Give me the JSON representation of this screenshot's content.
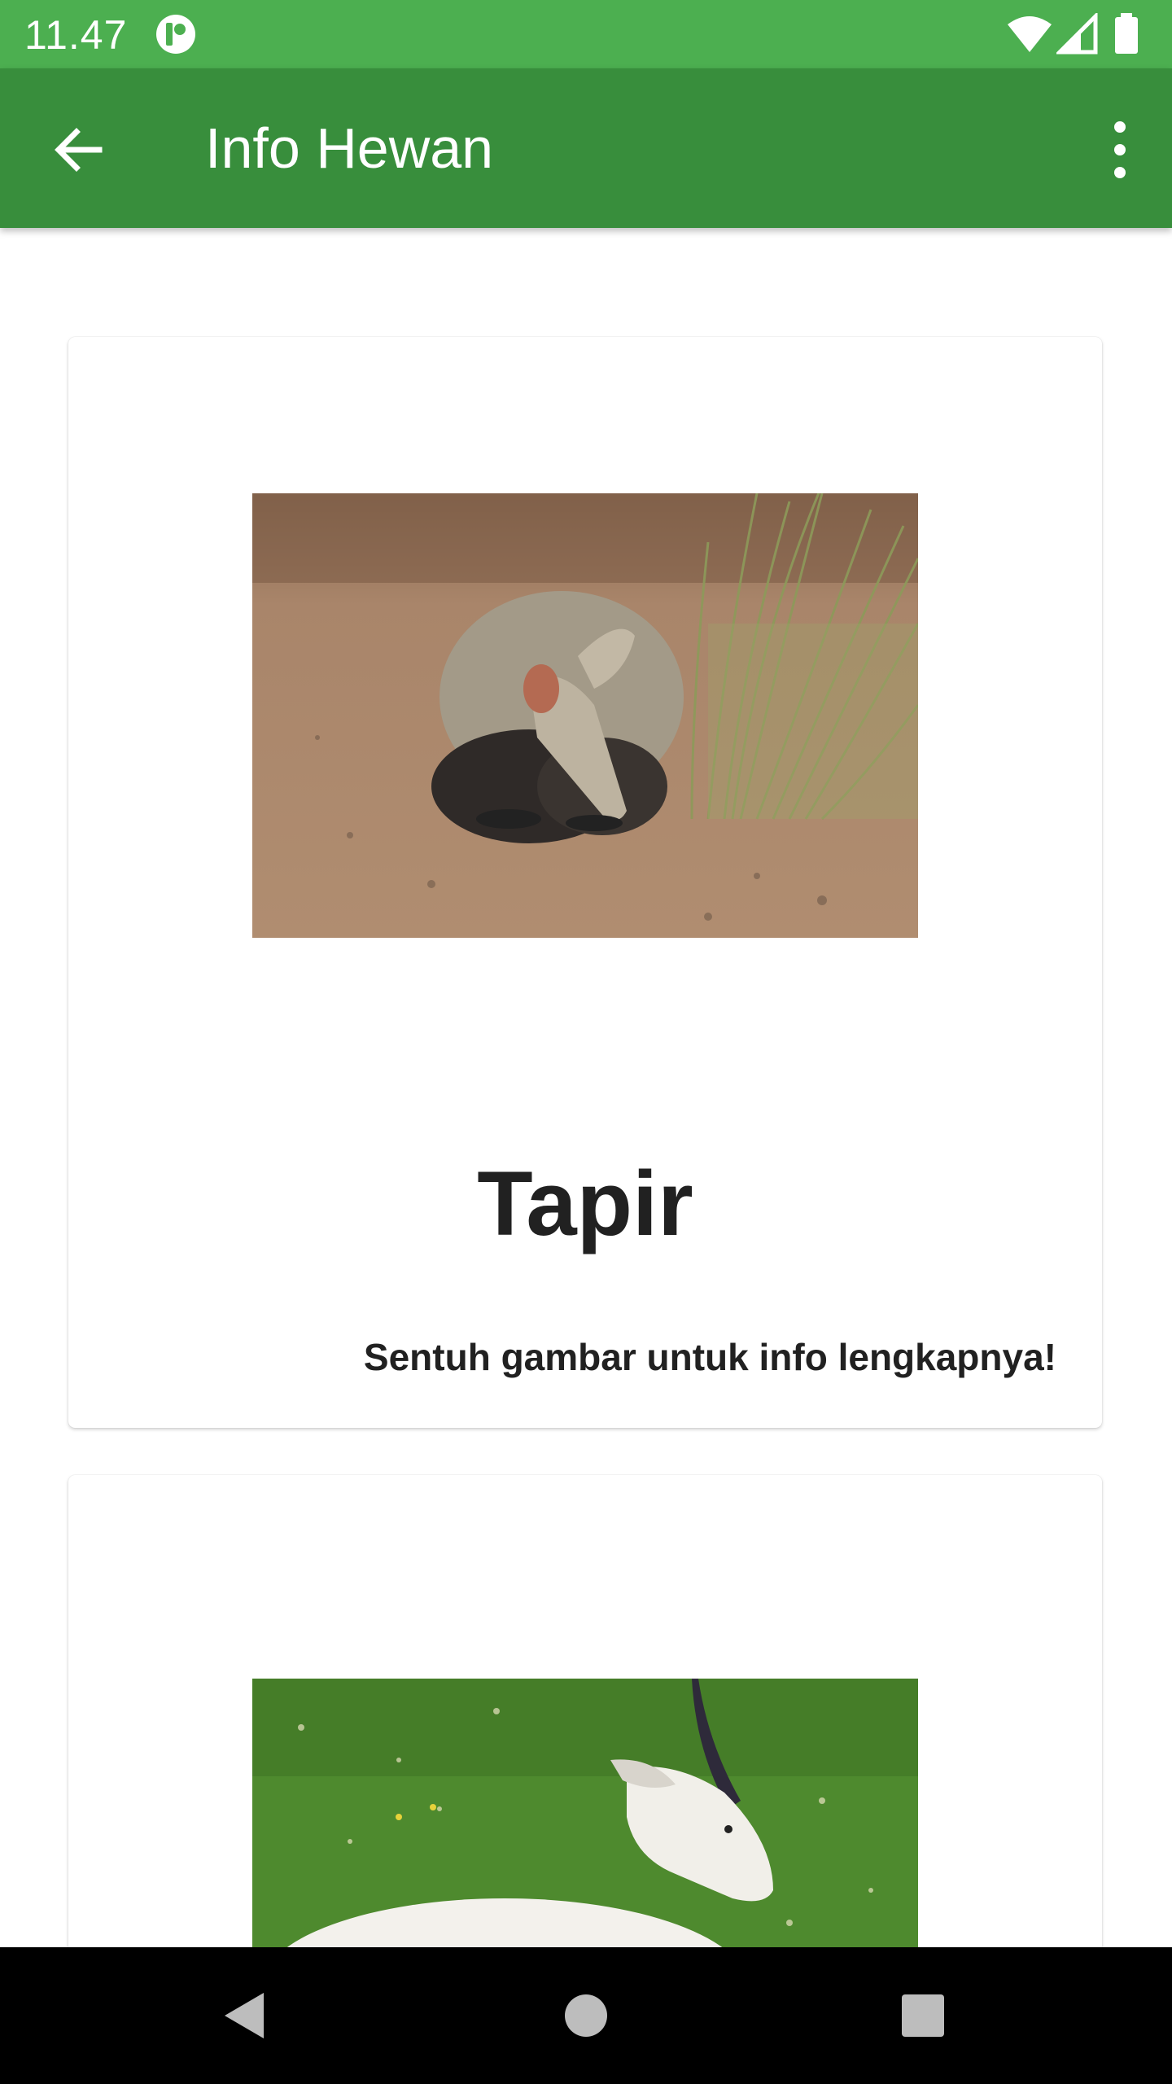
{
  "status_bar": {
    "time": "11.47",
    "icons": [
      "app-notification-icon",
      "wifi-icon",
      "cell-signal-icon",
      "battery-icon"
    ]
  },
  "app_bar": {
    "title": "Info Hewan",
    "back_icon": "arrow-back-icon",
    "menu_icon": "more-vert-icon",
    "color": "#388e3c"
  },
  "cards": [
    {
      "name": "Tapir",
      "hint": "Sentuh gambar untuk info lengkapnya!"
    },
    {
      "name": "",
      "hint": ""
    }
  ],
  "nav_bar": {
    "icons": [
      "nav-back-icon",
      "nav-home-icon",
      "nav-recents-icon"
    ]
  },
  "colors": {
    "status_bar": "#4caf50",
    "app_bar": "#388e3c",
    "text_primary": "#212121"
  }
}
